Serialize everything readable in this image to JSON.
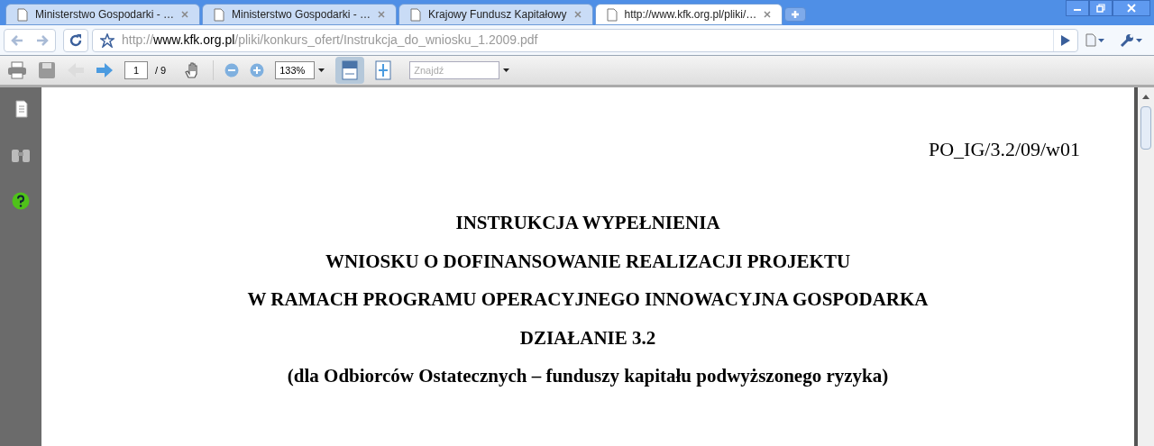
{
  "tabs": [
    {
      "title": "Ministerstwo Gospodarki - …",
      "selected": false
    },
    {
      "title": "Ministerstwo Gospodarki - …",
      "selected": false
    },
    {
      "title": "Krajowy Fundusz Kapitałowy",
      "selected": false
    },
    {
      "title": "http://www.kfk.org.pl/pliki/…",
      "selected": true
    }
  ],
  "address_bar": {
    "scheme": "http://",
    "host": "www.kfk.org.pl",
    "path": "/pliki/konkurs_ofert/Instrukcja_do_wniosku_1.2009.pdf"
  },
  "pdf_toolbar": {
    "page": "1",
    "page_total": "/ 9",
    "zoom": "133%",
    "find_placeholder": "Znajdź",
    "fit_width_selected": true
  },
  "document": {
    "reference": "PO_IG/3.2/09/w01",
    "title_lines": [
      "INSTRUKCJA WYPEŁNIENIA",
      "WNIOSKU O DOFINANSOWANIE REALIZACJI PROJEKTU",
      "W RAMACH PROGRAMU OPERACYJNEGO INNOWACYJNA GOSPODARKA",
      "DZIAŁANIE 3.2",
      "(dla Odbiorców Ostatecznych – funduszy kapitału podwyższonego ryzyka)"
    ]
  }
}
